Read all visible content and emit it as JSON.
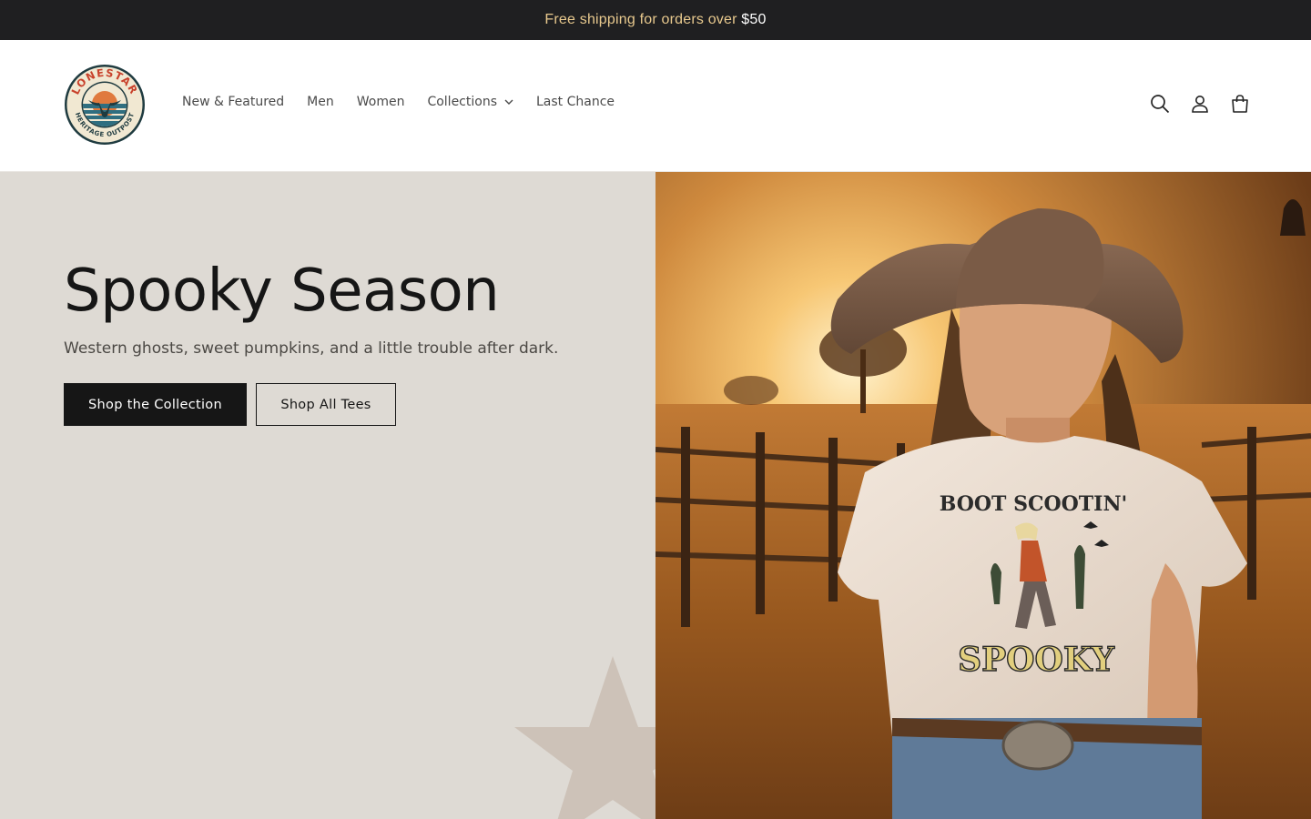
{
  "announcement": {
    "text": "Free shipping for orders over ",
    "amount": "$50"
  },
  "brand": {
    "logo_top_text": "LONESTAR",
    "logo_bottom_text": "HERITAGE OUTPOST"
  },
  "nav": {
    "items": [
      {
        "label": "New & Featured"
      },
      {
        "label": "Men"
      },
      {
        "label": "Women"
      },
      {
        "label": "Collections",
        "has_dropdown": true
      },
      {
        "label": "Last Chance"
      }
    ]
  },
  "header_icons": [
    "search-icon",
    "account-icon",
    "cart-icon"
  ],
  "hero": {
    "title": "Spooky Season",
    "subtitle": "Western ghosts, sweet pumpkins, and a little trouble after dark.",
    "primary_button": "Shop the Collection",
    "secondary_button": "Shop All Tees",
    "shirt_top_text": "BOOT SCOOTIN'",
    "shirt_bottom_text": "SPOOKY"
  },
  "colors": {
    "announcement_bg": "#1f1f21",
    "announcement_text": "#e8c98e",
    "hero_bg": "#dedad4",
    "button_dark": "#161616",
    "star": "#cdc2b8"
  }
}
